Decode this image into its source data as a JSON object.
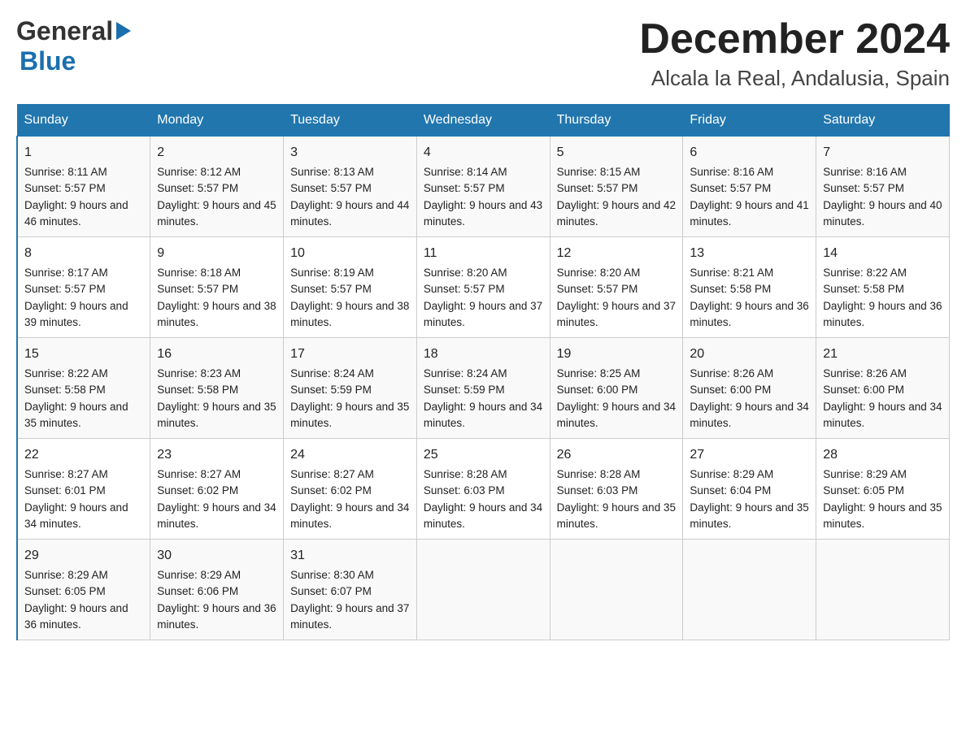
{
  "logo": {
    "text_general": "General",
    "text_blue": "Blue",
    "triangle": "▶"
  },
  "title": "December 2024",
  "subtitle": "Alcala la Real, Andalusia, Spain",
  "days_of_week": [
    "Sunday",
    "Monday",
    "Tuesday",
    "Wednesday",
    "Thursday",
    "Friday",
    "Saturday"
  ],
  "weeks": [
    [
      {
        "day": "1",
        "sunrise": "8:11 AM",
        "sunset": "5:57 PM",
        "daylight": "9 hours and 46 minutes."
      },
      {
        "day": "2",
        "sunrise": "8:12 AM",
        "sunset": "5:57 PM",
        "daylight": "9 hours and 45 minutes."
      },
      {
        "day": "3",
        "sunrise": "8:13 AM",
        "sunset": "5:57 PM",
        "daylight": "9 hours and 44 minutes."
      },
      {
        "day": "4",
        "sunrise": "8:14 AM",
        "sunset": "5:57 PM",
        "daylight": "9 hours and 43 minutes."
      },
      {
        "day": "5",
        "sunrise": "8:15 AM",
        "sunset": "5:57 PM",
        "daylight": "9 hours and 42 minutes."
      },
      {
        "day": "6",
        "sunrise": "8:16 AM",
        "sunset": "5:57 PM",
        "daylight": "9 hours and 41 minutes."
      },
      {
        "day": "7",
        "sunrise": "8:16 AM",
        "sunset": "5:57 PM",
        "daylight": "9 hours and 40 minutes."
      }
    ],
    [
      {
        "day": "8",
        "sunrise": "8:17 AM",
        "sunset": "5:57 PM",
        "daylight": "9 hours and 39 minutes."
      },
      {
        "day": "9",
        "sunrise": "8:18 AM",
        "sunset": "5:57 PM",
        "daylight": "9 hours and 38 minutes."
      },
      {
        "day": "10",
        "sunrise": "8:19 AM",
        "sunset": "5:57 PM",
        "daylight": "9 hours and 38 minutes."
      },
      {
        "day": "11",
        "sunrise": "8:20 AM",
        "sunset": "5:57 PM",
        "daylight": "9 hours and 37 minutes."
      },
      {
        "day": "12",
        "sunrise": "8:20 AM",
        "sunset": "5:57 PM",
        "daylight": "9 hours and 37 minutes."
      },
      {
        "day": "13",
        "sunrise": "8:21 AM",
        "sunset": "5:58 PM",
        "daylight": "9 hours and 36 minutes."
      },
      {
        "day": "14",
        "sunrise": "8:22 AM",
        "sunset": "5:58 PM",
        "daylight": "9 hours and 36 minutes."
      }
    ],
    [
      {
        "day": "15",
        "sunrise": "8:22 AM",
        "sunset": "5:58 PM",
        "daylight": "9 hours and 35 minutes."
      },
      {
        "day": "16",
        "sunrise": "8:23 AM",
        "sunset": "5:58 PM",
        "daylight": "9 hours and 35 minutes."
      },
      {
        "day": "17",
        "sunrise": "8:24 AM",
        "sunset": "5:59 PM",
        "daylight": "9 hours and 35 minutes."
      },
      {
        "day": "18",
        "sunrise": "8:24 AM",
        "sunset": "5:59 PM",
        "daylight": "9 hours and 34 minutes."
      },
      {
        "day": "19",
        "sunrise": "8:25 AM",
        "sunset": "6:00 PM",
        "daylight": "9 hours and 34 minutes."
      },
      {
        "day": "20",
        "sunrise": "8:26 AM",
        "sunset": "6:00 PM",
        "daylight": "9 hours and 34 minutes."
      },
      {
        "day": "21",
        "sunrise": "8:26 AM",
        "sunset": "6:00 PM",
        "daylight": "9 hours and 34 minutes."
      }
    ],
    [
      {
        "day": "22",
        "sunrise": "8:27 AM",
        "sunset": "6:01 PM",
        "daylight": "9 hours and 34 minutes."
      },
      {
        "day": "23",
        "sunrise": "8:27 AM",
        "sunset": "6:02 PM",
        "daylight": "9 hours and 34 minutes."
      },
      {
        "day": "24",
        "sunrise": "8:27 AM",
        "sunset": "6:02 PM",
        "daylight": "9 hours and 34 minutes."
      },
      {
        "day": "25",
        "sunrise": "8:28 AM",
        "sunset": "6:03 PM",
        "daylight": "9 hours and 34 minutes."
      },
      {
        "day": "26",
        "sunrise": "8:28 AM",
        "sunset": "6:03 PM",
        "daylight": "9 hours and 35 minutes."
      },
      {
        "day": "27",
        "sunrise": "8:29 AM",
        "sunset": "6:04 PM",
        "daylight": "9 hours and 35 minutes."
      },
      {
        "day": "28",
        "sunrise": "8:29 AM",
        "sunset": "6:05 PM",
        "daylight": "9 hours and 35 minutes."
      }
    ],
    [
      {
        "day": "29",
        "sunrise": "8:29 AM",
        "sunset": "6:05 PM",
        "daylight": "9 hours and 36 minutes."
      },
      {
        "day": "30",
        "sunrise": "8:29 AM",
        "sunset": "6:06 PM",
        "daylight": "9 hours and 36 minutes."
      },
      {
        "day": "31",
        "sunrise": "8:30 AM",
        "sunset": "6:07 PM",
        "daylight": "9 hours and 37 minutes."
      },
      {
        "day": "",
        "sunrise": "",
        "sunset": "",
        "daylight": ""
      },
      {
        "day": "",
        "sunrise": "",
        "sunset": "",
        "daylight": ""
      },
      {
        "day": "",
        "sunrise": "",
        "sunset": "",
        "daylight": ""
      },
      {
        "day": "",
        "sunrise": "",
        "sunset": "",
        "daylight": ""
      }
    ]
  ]
}
